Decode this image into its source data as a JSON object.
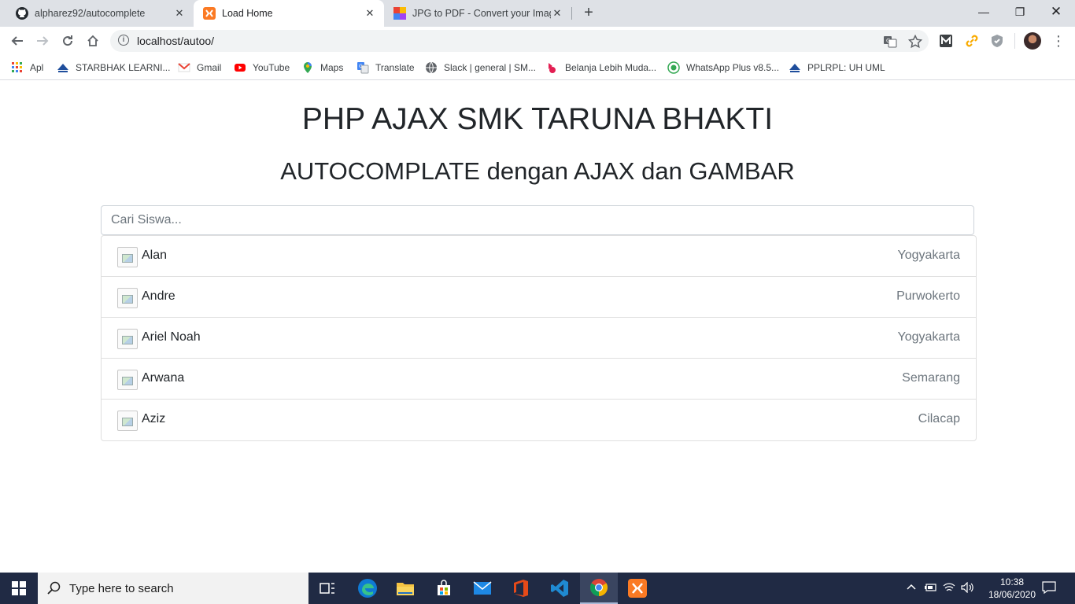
{
  "browser": {
    "tabs": [
      {
        "title": "alpharez92/autocomplete",
        "icon": "github-icon",
        "active": false
      },
      {
        "title": "Load Home",
        "icon": "xampp-icon",
        "active": true
      },
      {
        "title": "JPG to PDF - Convert your Image",
        "icon": "jpg2pdf-icon",
        "active": false
      }
    ],
    "new_tab_label": "+",
    "url": "localhost/autoo/",
    "bookmarks": [
      {
        "label": "Apl",
        "icon": "apps-grid-icon"
      },
      {
        "label": "STARBHAK LEARNI...",
        "icon": "starbhak-icon"
      },
      {
        "label": "Gmail",
        "icon": "gmail-icon"
      },
      {
        "label": "YouTube",
        "icon": "youtube-icon"
      },
      {
        "label": "Maps",
        "icon": "maps-icon"
      },
      {
        "label": "Translate",
        "icon": "translate-icon"
      },
      {
        "label": "Slack | general | SM...",
        "icon": "globe-icon"
      },
      {
        "label": "Belanja Lebih Muda...",
        "icon": "bukalapak-icon"
      },
      {
        "label": "WhatsApp Plus v8.5...",
        "icon": "whatsapp-plus-icon"
      },
      {
        "label": "PPLRPL: UH UML",
        "icon": "starbhak-icon"
      }
    ]
  },
  "page": {
    "title": "PHP AJAX SMK TARUNA BHAKTI",
    "subtitle": "AUTOCOMPLATE dengan AJAX dan GAMBAR",
    "search_placeholder": "Cari Siswa...",
    "search_value": "",
    "results": [
      {
        "name": "Alan",
        "city": "Yogyakarta"
      },
      {
        "name": "Andre",
        "city": "Purwokerto"
      },
      {
        "name": "Ariel Noah",
        "city": "Yogyakarta"
      },
      {
        "name": "Arwana",
        "city": "Semarang"
      },
      {
        "name": "Aziz",
        "city": "Cilacap"
      }
    ]
  },
  "taskbar": {
    "search_text": "Type here to search",
    "time": "10:38",
    "date": "18/06/2020"
  },
  "colors": {
    "accent": "#1a73e8",
    "taskbar_bg": "#202a44",
    "tabstrip_bg": "#dee1e6"
  }
}
